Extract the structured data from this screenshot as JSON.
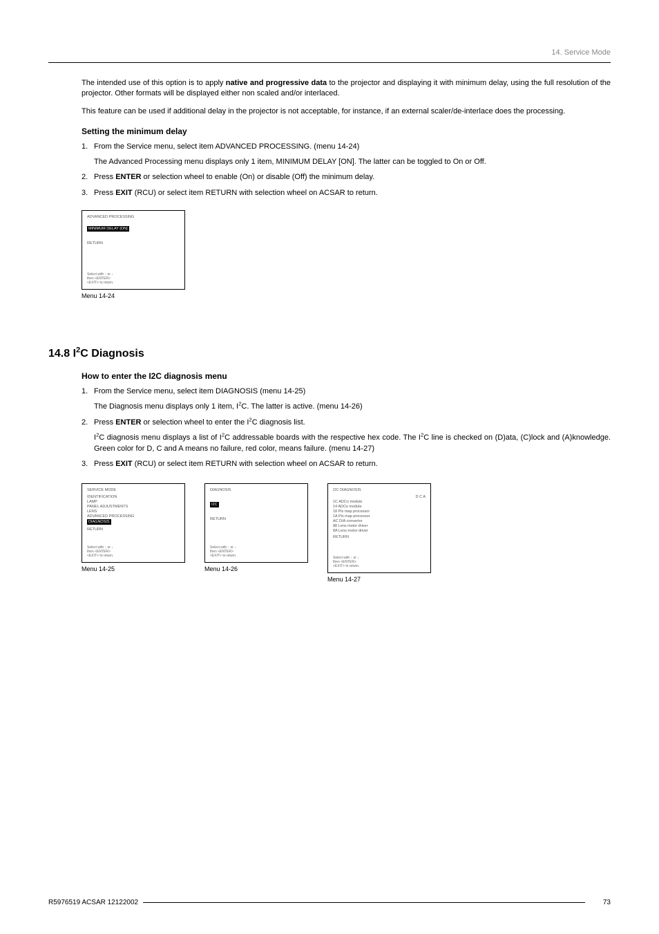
{
  "header": {
    "right": "14. Service Mode"
  },
  "intro": {
    "p1_a": "The intended use of this option is to apply ",
    "p1_bold": "native and progressive data",
    "p1_b": " to the projector and displaying it with minimum delay, using the full resolution of the projector. Other formats will be displayed either non scaled and/or interlaced.",
    "p2": "This feature can be used if additional delay in the projector is not acceptable, for instance, if an external scaler/de-interlace does the processing."
  },
  "sec1": {
    "title": "Setting the minimum delay",
    "s1_a": "From the Service menu, select item ADVANCED PROCESSING. (menu 14-24)",
    "s1_sub": "The Advanced Processing menu displays only 1 item, MINIMUM DELAY [ON]. The latter can be toggled to On or Off.",
    "s2_a": "Press ",
    "s2_bold": "ENTER",
    "s2_b": " or selection wheel to enable (On) or disable (Off) the minimum delay.",
    "s3_a": "Press ",
    "s3_bold": "EXIT",
    "s3_b": " (RCU) or select item RETURN with selection wheel on ACSAR to return."
  },
  "menu24": {
    "title": "ADVANCED PROCESSING",
    "selected": "MINIMUM DELAY [ON]",
    "return": "RETURN",
    "foot_a": "Select with ↑ or ↓",
    "foot_b": "then <ENTER>",
    "foot_c": "<EXIT> to return.",
    "caption": "Menu 14-24"
  },
  "sec2": {
    "head_a": "14.8 I",
    "head_b": "C Diagnosis",
    "title": "How to enter the I2C diagnosis menu",
    "s1_a": "From the Service menu, select item DIAGNOSIS (menu 14-25)",
    "s1_sub_a": "The Diagnosis menu displays only 1 item, I",
    "s1_sub_b": "C. The latter is active. (menu 14-26)",
    "s2_a": "Press ",
    "s2_bold": "ENTER",
    "s2_b": " or selection wheel to enter the I",
    "s2_c": "C diagnosis list.",
    "s2_sub_a": "I",
    "s2_sub_b": "C diagnosis menu displays a list of I",
    "s2_sub_c": "C addressable boards with the respective hex code. The I",
    "s2_sub_d": "C line is checked on (D)ata, (C)lock and (A)knowledge. Green color for D, C and A means no failure, red color, means failure. (menu 14-27)",
    "s3_a": "Press ",
    "s3_bold": "EXIT",
    "s3_b": " (RCU) or select item RETURN with selection wheel on ACSAR to return."
  },
  "menu25": {
    "title": "SERVICE MODE",
    "items": [
      "IDENTIFICATION",
      "LAMP",
      "PANEL ADJUSTMENTS",
      "LENS",
      "ADVANCED PROCESSING"
    ],
    "selected": "DIAGNOSIS",
    "return": "RETURN",
    "foot_a": "Select with ↑ or ↓",
    "foot_b": "then <ENTER>",
    "foot_c": "<EXIT> to return.",
    "caption": "Menu 14-25"
  },
  "menu26": {
    "title": "DIAGNOSIS",
    "selected": "I2C",
    "return": "RETURN",
    "foot_a": "Select with ↑ or ↓",
    "foot_b": "then <ENTER>",
    "foot_c": "<EXIT> to return.",
    "caption": "Menu 14-26"
  },
  "menu27": {
    "title": "I2C DIAGNOSIS",
    "header_row": "D C A",
    "items": [
      "1C ADCo module",
      "14 ADCe module",
      "18 Pix map processor",
      "1A Pix map processor",
      "AC D/A convertor",
      "88 Lens motor driver",
      "8A Lens motor driver"
    ],
    "return": "RETURN",
    "foot_a": "Select with ↑ or ↓",
    "foot_b": "then <ENTER>",
    "foot_c": "<EXIT> to return.",
    "caption": "Menu 14-27"
  },
  "footer": {
    "left": "R5976519  ACSAR  12122002",
    "page": "73"
  }
}
